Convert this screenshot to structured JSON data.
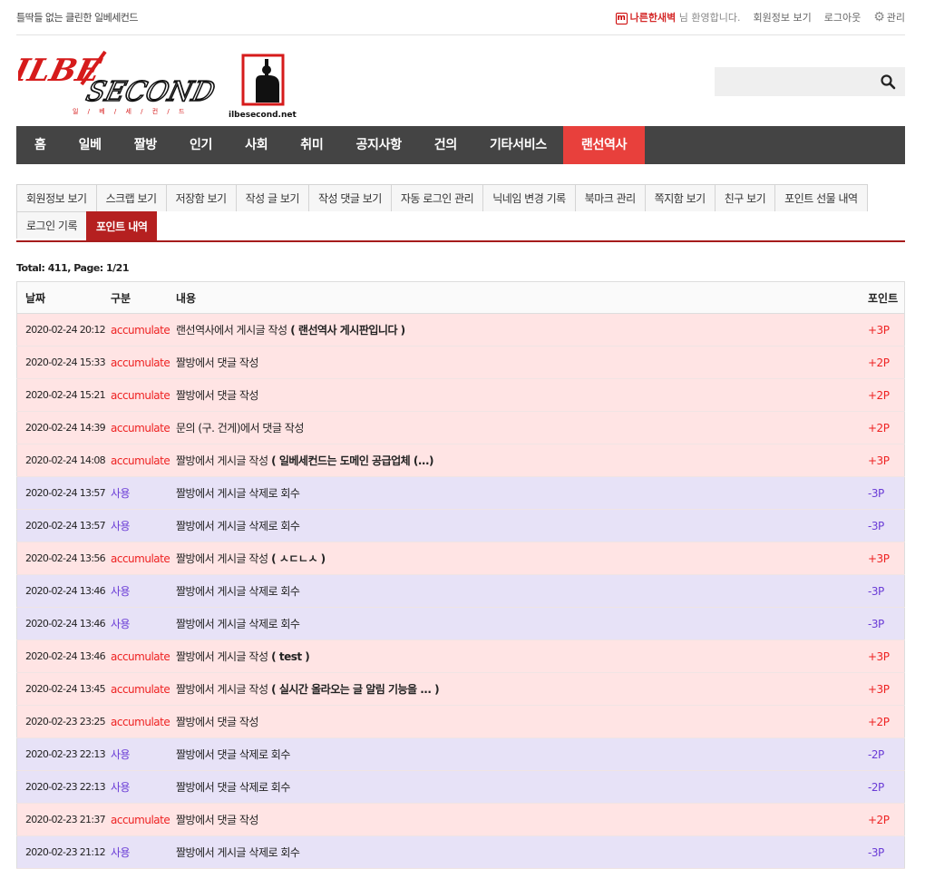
{
  "topbar": {
    "slogan": "틀딱들 없는 클린한 일베세컨드",
    "user_badge": "m",
    "nickname": "나른한새벽",
    "greeting": "님 환영합니다.",
    "links": [
      "회원정보 보기",
      "로그아웃"
    ],
    "admin_label": "관리"
  },
  "logo": {
    "line1": "ILBE",
    "line2": "SECOND",
    "sub": "일 / 베 / 세 / 컨 / 드",
    "domain": "ilbesecond.net"
  },
  "search": {
    "icon": "search-icon"
  },
  "nav": {
    "items": [
      "홈",
      "일베",
      "짤방",
      "인기",
      "사회",
      "취미",
      "공지사항",
      "건의",
      "기타서비스",
      "랜선역사"
    ],
    "active_index": 9
  },
  "tabs": {
    "items": [
      "회원정보 보기",
      "스크랩 보기",
      "저장함 보기",
      "작성 글 보기",
      "작성 댓글 보기",
      "자동 로그인 관리",
      "닉네임 변경 기록",
      "북마크 관리",
      "쪽지함 보기",
      "친구 보기",
      "포인트 선물 내역",
      "로그인 기록",
      "포인트 내역"
    ],
    "active_index": 12
  },
  "summary": "Total: 411, Page: 1/21",
  "table": {
    "headers": [
      "날짜",
      "구분",
      "내용",
      "포인트"
    ],
    "rows": [
      {
        "date": "2020-02-24 20:12",
        "type": "accumulate",
        "text": "랜선역사에서 게시글 작성",
        "bold": "( 랜선역사 게시판입니다 )",
        "points": "+3P"
      },
      {
        "date": "2020-02-24 15:33",
        "type": "accumulate",
        "text": "짤방에서 댓글 작성",
        "bold": "",
        "points": "+2P"
      },
      {
        "date": "2020-02-24 15:21",
        "type": "accumulate",
        "text": "짤방에서 댓글 작성",
        "bold": "",
        "points": "+2P"
      },
      {
        "date": "2020-02-24 14:39",
        "type": "accumulate",
        "text": "문의 (구. 건게)에서 댓글 작성",
        "bold": "",
        "points": "+2P"
      },
      {
        "date": "2020-02-24 14:08",
        "type": "accumulate",
        "text": "짤방에서 게시글 작성",
        "bold": "( 일베세컨드는 도메인 공급업체 (...)",
        "points": "+3P"
      },
      {
        "date": "2020-02-24 13:57",
        "type": "사용",
        "text": "짤방에서 게시글 삭제로 회수",
        "bold": "",
        "points": "-3P"
      },
      {
        "date": "2020-02-24 13:57",
        "type": "사용",
        "text": "짤방에서 게시글 삭제로 회수",
        "bold": "",
        "points": "-3P"
      },
      {
        "date": "2020-02-24 13:56",
        "type": "accumulate",
        "text": "짤방에서 게시글 작성",
        "bold": "( ㅅㄷㄴㅅ )",
        "points": "+3P"
      },
      {
        "date": "2020-02-24 13:46",
        "type": "사용",
        "text": "짤방에서 게시글 삭제로 회수",
        "bold": "",
        "points": "-3P"
      },
      {
        "date": "2020-02-24 13:46",
        "type": "사용",
        "text": "짤방에서 게시글 삭제로 회수",
        "bold": "",
        "points": "-3P"
      },
      {
        "date": "2020-02-24 13:46",
        "type": "accumulate",
        "text": "짤방에서 게시글 작성",
        "bold": "( test )",
        "points": "+3P"
      },
      {
        "date": "2020-02-24 13:45",
        "type": "accumulate",
        "text": "짤방에서 게시글 작성",
        "bold": "( 실시간 올라오는 글 알림 기능을 ... )",
        "points": "+3P"
      },
      {
        "date": "2020-02-23 23:25",
        "type": "accumulate",
        "text": "짤방에서 댓글 작성",
        "bold": "",
        "points": "+2P"
      },
      {
        "date": "2020-02-23 22:13",
        "type": "사용",
        "text": "짤방에서 댓글 삭제로 회수",
        "bold": "",
        "points": "-2P"
      },
      {
        "date": "2020-02-23 22:13",
        "type": "사용",
        "text": "짤방에서 댓글 삭제로 회수",
        "bold": "",
        "points": "-2P"
      },
      {
        "date": "2020-02-23 21:37",
        "type": "accumulate",
        "text": "짤방에서 댓글 작성",
        "bold": "",
        "points": "+2P"
      },
      {
        "date": "2020-02-23 21:12",
        "type": "사용",
        "text": "짤방에서 게시글 삭제로 회수",
        "bold": "",
        "points": "-3P"
      }
    ]
  },
  "colors": {
    "accent_red": "#e8403c",
    "tab_active": "#b52020",
    "nav_bg": "#444444",
    "row_accumulate": "#ffe4e4",
    "row_use": "#e7e2f7",
    "text_accumulate": "#ee2222",
    "text_use": "#6a3cd6"
  }
}
